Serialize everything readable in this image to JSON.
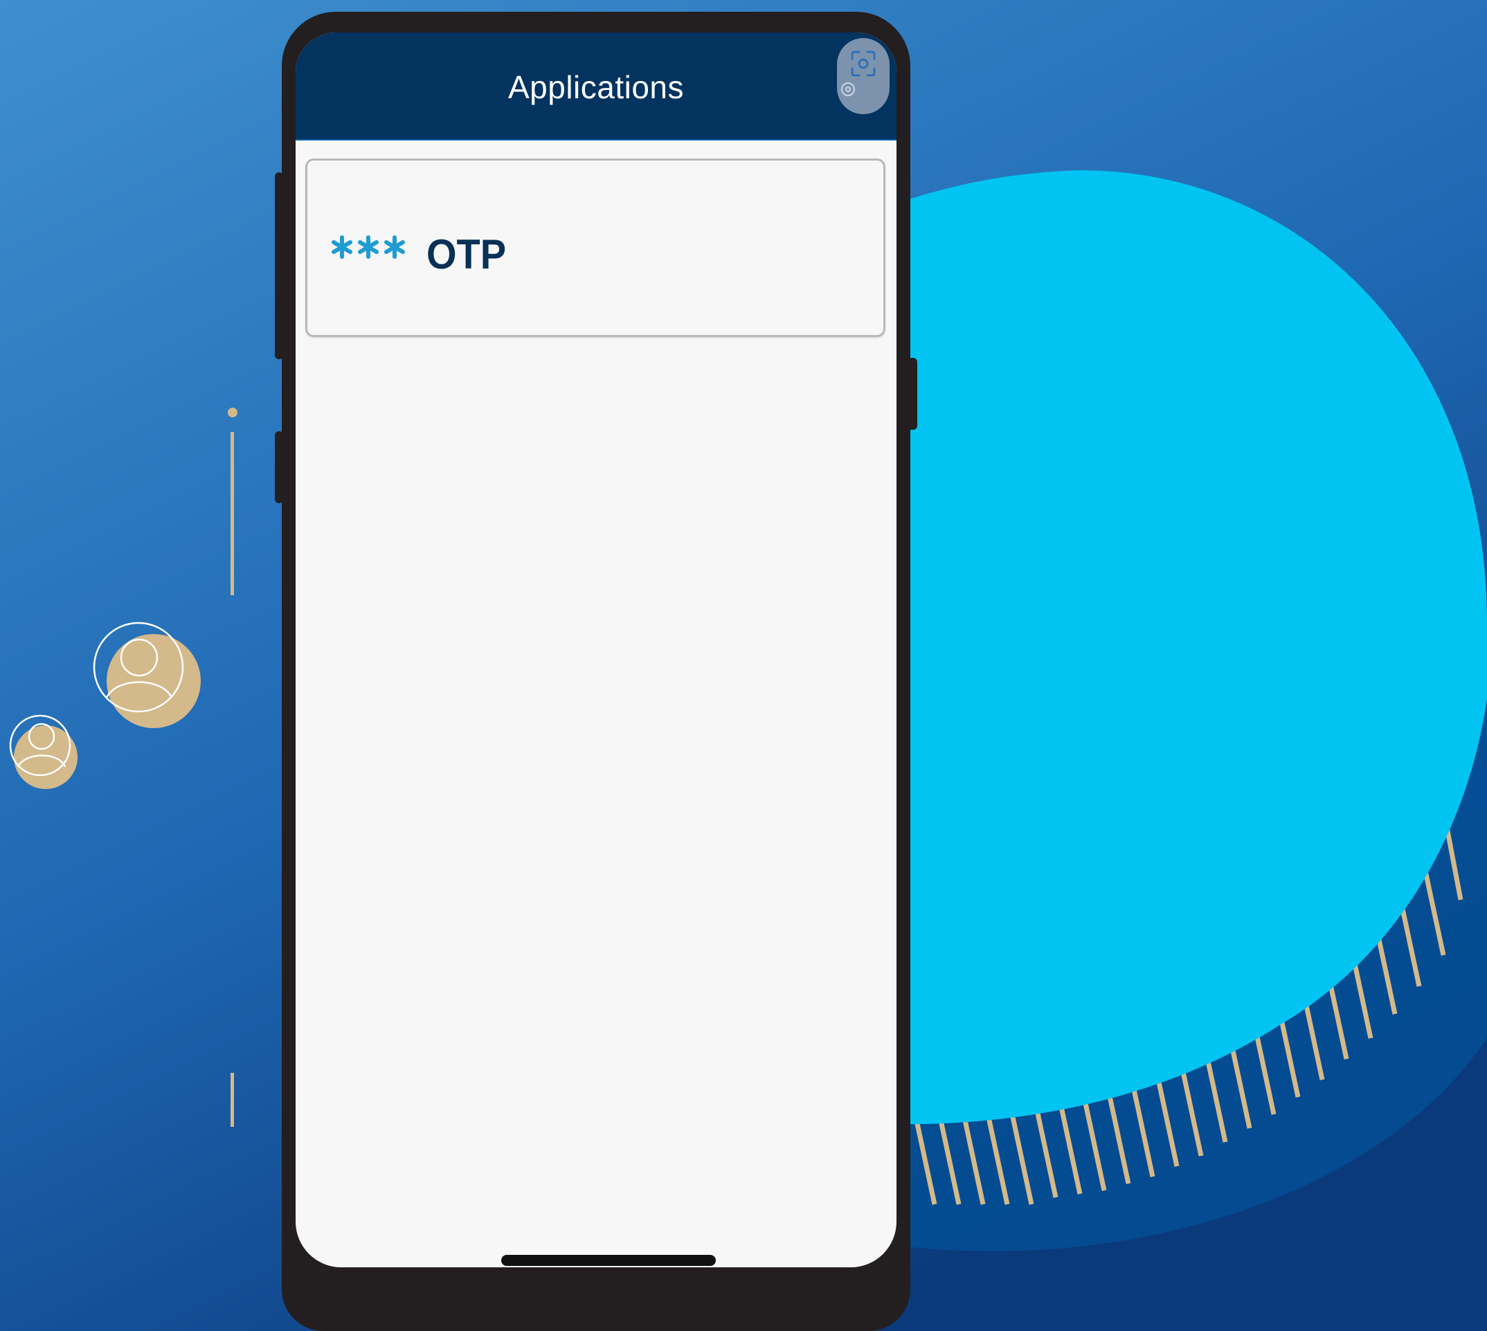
{
  "app": {
    "title": "Applications",
    "scan_icon": "qr-scan-icon",
    "otp_item": {
      "label": "OTP",
      "icon": "asterisks-icon"
    }
  },
  "colors": {
    "background_top": "#3f8fce",
    "background_bottom": "#0b3a7c",
    "blob": "#02c4f2",
    "blob_shadow": "#044f95",
    "gold": "#d4b98a",
    "phone_frame": "#231f20",
    "header": "#03335f",
    "screen": "#f7f7f7",
    "otp_text": "#093056",
    "otp_icon": "#1f9cd1"
  }
}
